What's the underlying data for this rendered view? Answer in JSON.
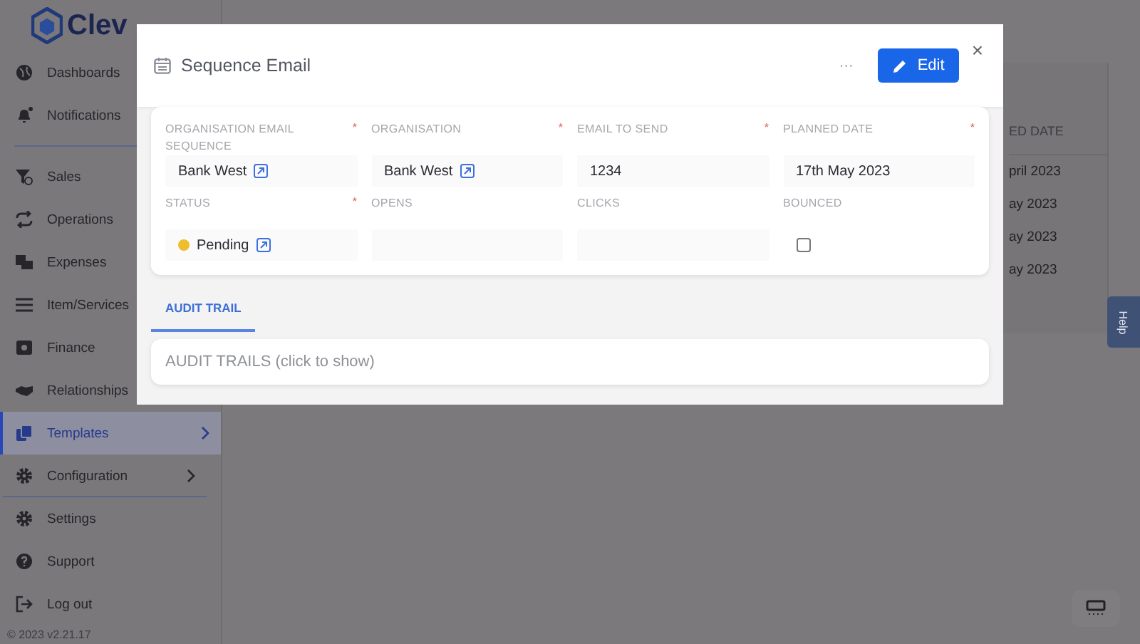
{
  "app": {
    "logo": "Clev"
  },
  "sidebar": {
    "items": [
      {
        "label": "Dashboards",
        "selected": false,
        "expandable": false
      },
      {
        "label": "Notifications",
        "selected": false,
        "expandable": false
      },
      {
        "label": "Sales",
        "selected": false,
        "expandable": false
      },
      {
        "label": "Operations",
        "selected": false,
        "expandable": false
      },
      {
        "label": "Expenses",
        "selected": false,
        "expandable": false
      },
      {
        "label": "Item/Services",
        "selected": false,
        "expandable": false
      },
      {
        "label": "Finance",
        "selected": false,
        "expandable": false
      },
      {
        "label": "Relationships",
        "selected": false,
        "expandable": false
      },
      {
        "label": "Templates",
        "selected": true,
        "expandable": true
      },
      {
        "label": "Configuration",
        "selected": false,
        "expandable": true
      },
      {
        "label": "Settings",
        "selected": false,
        "expandable": false
      },
      {
        "label": "Support",
        "selected": false,
        "expandable": false
      },
      {
        "label": "Log out",
        "selected": false,
        "expandable": false
      }
    ],
    "footer": "© 2023  v2.21.17"
  },
  "background_table": {
    "column_header": "ED DATE",
    "rows": [
      "pril 2023",
      "ay 2023",
      "ay 2023",
      "ay 2023"
    ]
  },
  "help_tab": "Help",
  "modal": {
    "title": "Sequence Email",
    "more": "···",
    "edit_button": "Edit",
    "close": "×",
    "required_mark": "*",
    "fields": [
      {
        "label": "ORGANISATION EMAIL SEQUENCE",
        "required": true,
        "kind": "link",
        "value": "Bank West"
      },
      {
        "label": "ORGANISATION",
        "required": true,
        "kind": "link",
        "value": "Bank West"
      },
      {
        "label": "EMAIL TO SEND",
        "required": true,
        "kind": "text",
        "value": "1234"
      },
      {
        "label": "PLANNED DATE",
        "required": true,
        "kind": "text",
        "value": "17th May 2023"
      },
      {
        "label": "STATUS",
        "required": true,
        "kind": "status",
        "value": "Pending",
        "color": "#f0bd2f"
      },
      {
        "label": "OPENS",
        "required": false,
        "kind": "text"
      },
      {
        "label": "CLICKS",
        "required": false,
        "kind": "text"
      },
      {
        "label": "BOUNCED",
        "required": false,
        "kind": "checkbox",
        "checked": false
      }
    ],
    "tabs": [
      {
        "label": "AUDIT TRAIL",
        "selected": true
      }
    ],
    "audit_panel": "AUDIT TRAILS (click to show)"
  }
}
